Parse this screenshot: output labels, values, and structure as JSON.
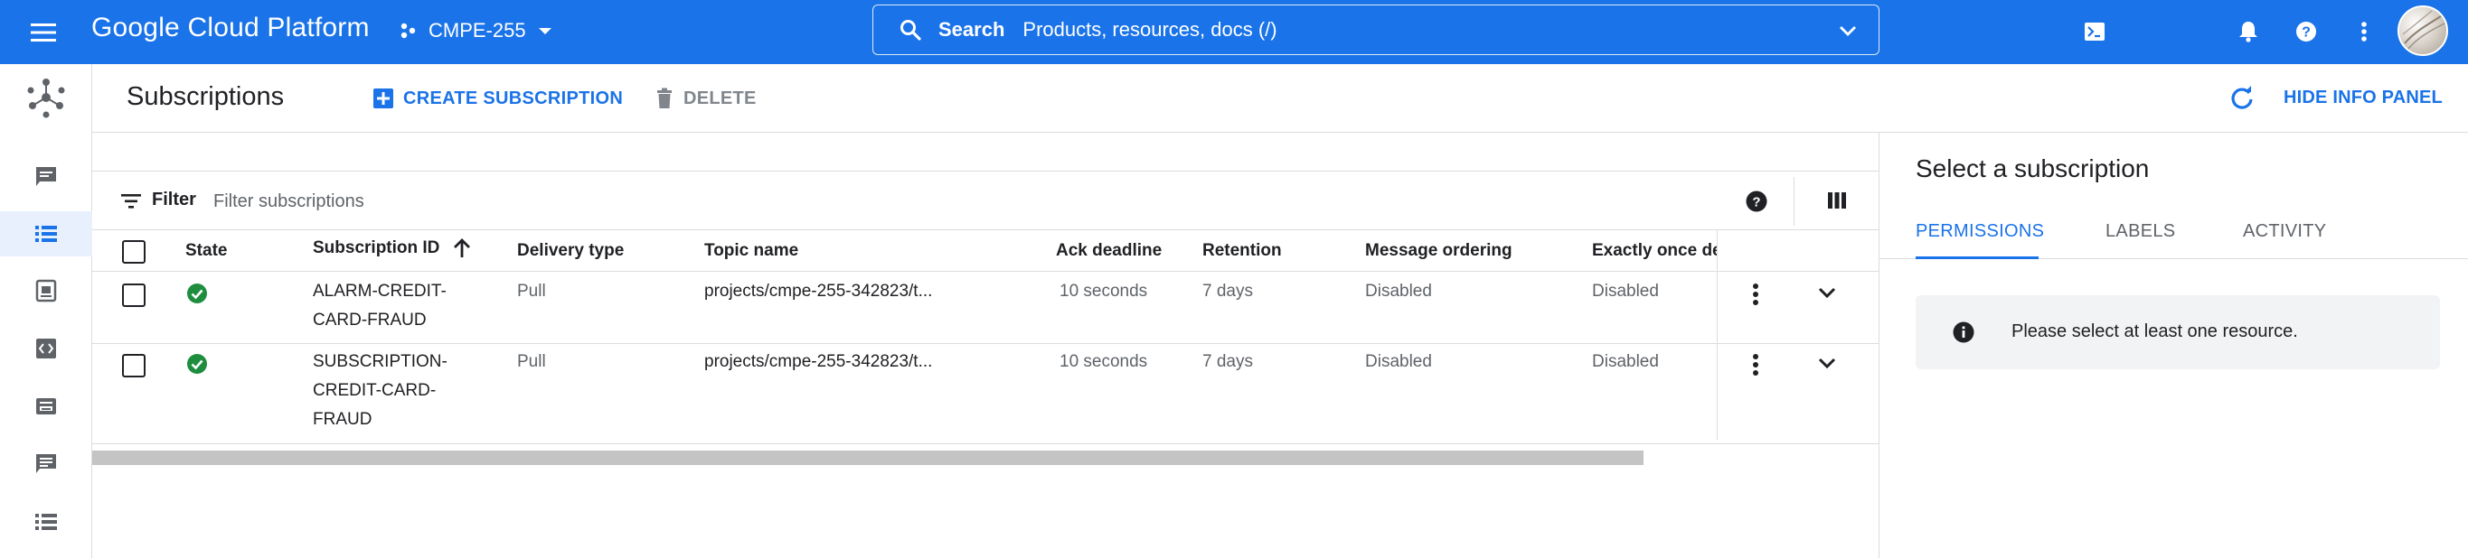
{
  "topbar": {
    "menu_icon": "menu-icon",
    "title": "Google Cloud Platform",
    "project": "CMPE-255",
    "search_label": "Search",
    "search_placeholder": "Products, resources, docs (/)",
    "icons": [
      "cloud-shell-icon",
      "notifications-icon",
      "help-icon",
      "more-vert-icon"
    ]
  },
  "leftnav": {
    "icons": [
      "pubsub-logo-icon",
      "topics-icon",
      "subscriptions-icon",
      "snapshots-icon",
      "schemas-icon",
      "lite-topics-icon",
      "lite-subscriptions-icon",
      "lite-reservations-icon"
    ],
    "active_index": 1,
    "colors": {
      "active_bg": "#e8f0fe",
      "active_icon": "#1a73e8",
      "icon": "#5f6368"
    }
  },
  "actionbar": {
    "title": "Subscriptions",
    "create_label": "CREATE SUBSCRIPTION",
    "delete_label": "DELETE",
    "hide_info_label": "HIDE INFO PANEL"
  },
  "filter": {
    "label": "Filter",
    "placeholder": "Filter subscriptions"
  },
  "table": {
    "columns": [
      "State",
      "Subscription ID",
      "Delivery type",
      "Topic name",
      "Ack deadline",
      "Retention",
      "Message ordering",
      "Exactly once del"
    ],
    "sort_column": "Subscription ID",
    "sort_direction": "ascending",
    "rows": [
      {
        "state": "check-circle-icon",
        "id_lines": [
          "ALARM-CREDIT-",
          "CARD-FRAUD"
        ],
        "delivery": "Pull",
        "topic": "projects/cmpe-255-342823/t...",
        "ack": "10 seconds",
        "retention": "7 days",
        "ordering": "Disabled",
        "exactly_once": "Disabled"
      },
      {
        "state": "check-circle-icon",
        "id_lines": [
          "SUBSCRIPTION-",
          "CREDIT-CARD-",
          "FRAUD"
        ],
        "delivery": "Pull",
        "topic": "projects/cmpe-255-342823/t...",
        "ack": "10 seconds",
        "retention": "7 days",
        "ordering": "Disabled",
        "exactly_once": "Disabled"
      }
    ]
  },
  "infopanel": {
    "title": "Select a subscription",
    "tabs": [
      "PERMISSIONS",
      "LABELS",
      "ACTIVITY"
    ],
    "active_tab": "PERMISSIONS",
    "message": "Please select at least one resource."
  },
  "colors": {
    "brand": "#1a73e8",
    "success": "#1e8e3e",
    "border": "#dadce0",
    "muted": "#5f6368"
  }
}
